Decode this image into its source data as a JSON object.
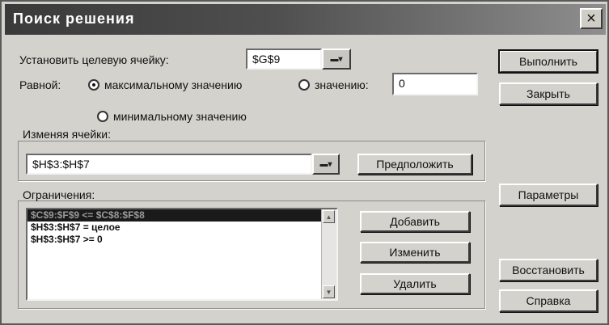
{
  "window": {
    "title": "Поиск решения",
    "close_label": "×"
  },
  "target": {
    "label": "Установить целевую ячейку:",
    "value": "$G$9"
  },
  "equal_to": {
    "label": "Равной:",
    "options": [
      {
        "label": "максимальному значению",
        "selected": true
      },
      {
        "label": "значению:",
        "selected": false
      },
      {
        "label": "минимальному значению",
        "selected": false
      }
    ],
    "value_field": "0"
  },
  "changing_cells": {
    "label": "Изменяя ячейки:",
    "value": "$H$3:$H$7"
  },
  "constraints": {
    "label": "Ограничения:",
    "items": [
      "$C$9:$F$9 <= $C$8:$F$8",
      "$H$3:$H$7 = целое",
      "$H$3:$H$7 >= 0"
    ],
    "selected_index": 0
  },
  "buttons": {
    "execute": "Выполнить",
    "close": "Закрыть",
    "guess": "Предположить",
    "options": "Параметры",
    "add": "Добавить",
    "change": "Изменить",
    "delete": "Удалить",
    "reset": "Восстановить",
    "help": "Справка"
  },
  "ref_button_glyph": "▬▾"
}
